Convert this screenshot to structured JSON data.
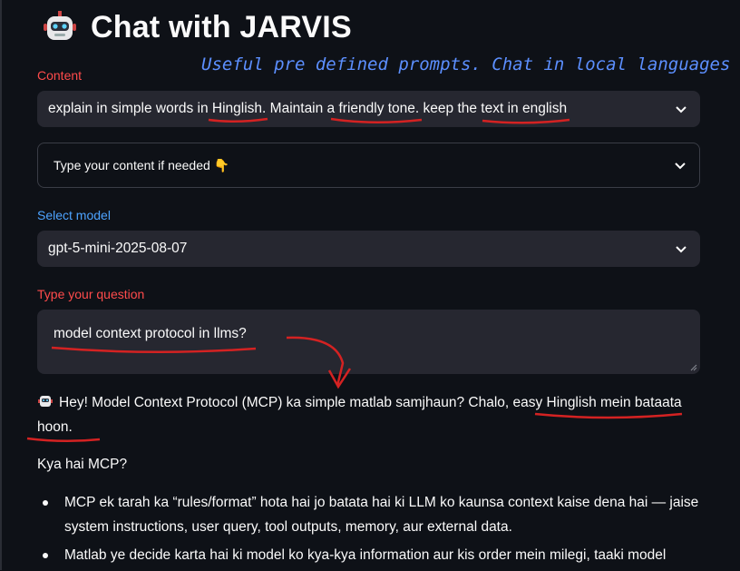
{
  "header": {
    "title": "Chat with JARVIS"
  },
  "annotation_note": "Useful pre defined prompts. Chat in local languages",
  "content": {
    "label": "Content",
    "selected": "explain in simple words in Hinglish. Maintain a friendly tone. keep the text in english",
    "expander_label": "Type your content if needed 👇"
  },
  "model": {
    "label": "Select model",
    "selected": "gpt-5-mini-2025-08-07"
  },
  "question": {
    "label": "Type your question",
    "value": "model context protocol in llms?"
  },
  "response": {
    "intro": "Hey! Model Context Protocol (MCP) ka simple matlab samjhaun? Chalo, easy Hinglish mein bataata hoon.",
    "subheading": "Kya hai MCP?",
    "bullets": [
      "MCP ek tarah ka “rules/format” hota hai jo batata hai ki LLM ko kaunsa context kaise dena hai — jaise system instructions, user query, tool outputs, memory, aur external data.",
      "Matlab ye decide karta hai ki model ko kya-kya information aur kis order mein milegi, taaki model"
    ]
  },
  "colors": {
    "background": "#0e1117",
    "input": "#262730",
    "accent_red": "#ff4b4b",
    "accent_blue": "#4da3ff",
    "ink_red": "#d42222"
  }
}
